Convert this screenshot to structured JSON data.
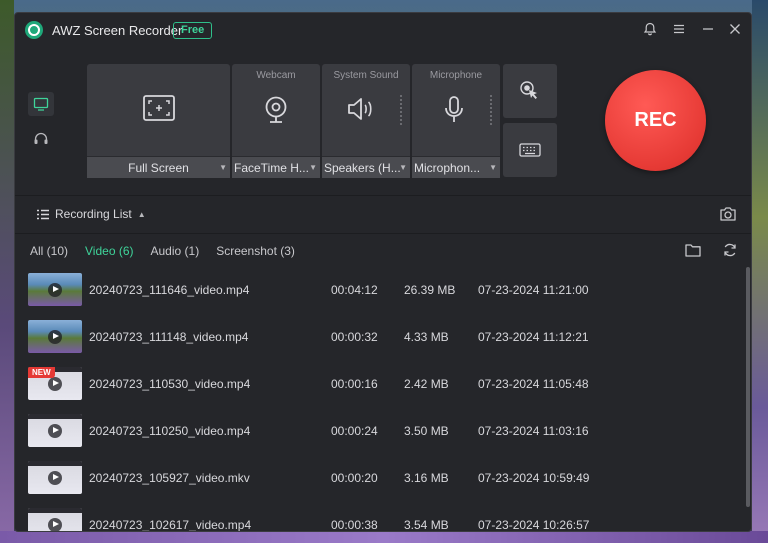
{
  "app": {
    "title": "AWZ Screen Recorder",
    "badge": "Free"
  },
  "titlebar": {
    "icons": [
      "bell-icon",
      "menu-icon",
      "minimize-icon",
      "close-icon"
    ]
  },
  "sources": {
    "screen": {
      "label": "",
      "selected": "Full Screen"
    },
    "webcam": {
      "label": "Webcam",
      "selected": "FaceTime H..."
    },
    "system_sound": {
      "label": "System Sound",
      "selected": "Speakers (H..."
    },
    "microphone": {
      "label": "Microphone",
      "selected": "Microphon..."
    }
  },
  "rec_label": "REC",
  "recording_list": {
    "label": "Recording List"
  },
  "tabs": [
    {
      "label": "All (10)",
      "active": false
    },
    {
      "label": "Video (6)",
      "active": true
    },
    {
      "label": "Audio (1)",
      "active": false
    },
    {
      "label": "Screenshot (3)",
      "active": false
    }
  ],
  "rows": [
    {
      "name": "20240723_111646_video.mp4",
      "duration": "00:04:12",
      "size": "26.39 MB",
      "date": "07-23-2024 11:21:00",
      "thumb": "landscape",
      "new": ""
    },
    {
      "name": "20240723_111148_video.mp4",
      "duration": "00:00:32",
      "size": "4.33 MB",
      "date": "07-23-2024 11:12:21",
      "thumb": "landscape",
      "new": ""
    },
    {
      "name": "20240723_110530_video.mp4",
      "duration": "00:00:16",
      "size": "2.42 MB",
      "date": "07-23-2024 11:05:48",
      "thumb": "ui",
      "new": "NEW"
    },
    {
      "name": "20240723_110250_video.mp4",
      "duration": "00:00:24",
      "size": "3.50 MB",
      "date": "07-23-2024 11:03:16",
      "thumb": "ui",
      "new": ""
    },
    {
      "name": "20240723_105927_video.mkv",
      "duration": "00:00:20",
      "size": "3.16 MB",
      "date": "07-23-2024 10:59:49",
      "thumb": "ui",
      "new": ""
    },
    {
      "name": "20240723_102617_video.mp4",
      "duration": "00:00:38",
      "size": "3.54 MB",
      "date": "07-23-2024 10:26:57",
      "thumb": "ui",
      "new": ""
    }
  ],
  "colors": {
    "accent": "#3fd49a",
    "rec": "#e63a35",
    "window_bg": "#25262a",
    "card_bg": "#3a3b40"
  }
}
